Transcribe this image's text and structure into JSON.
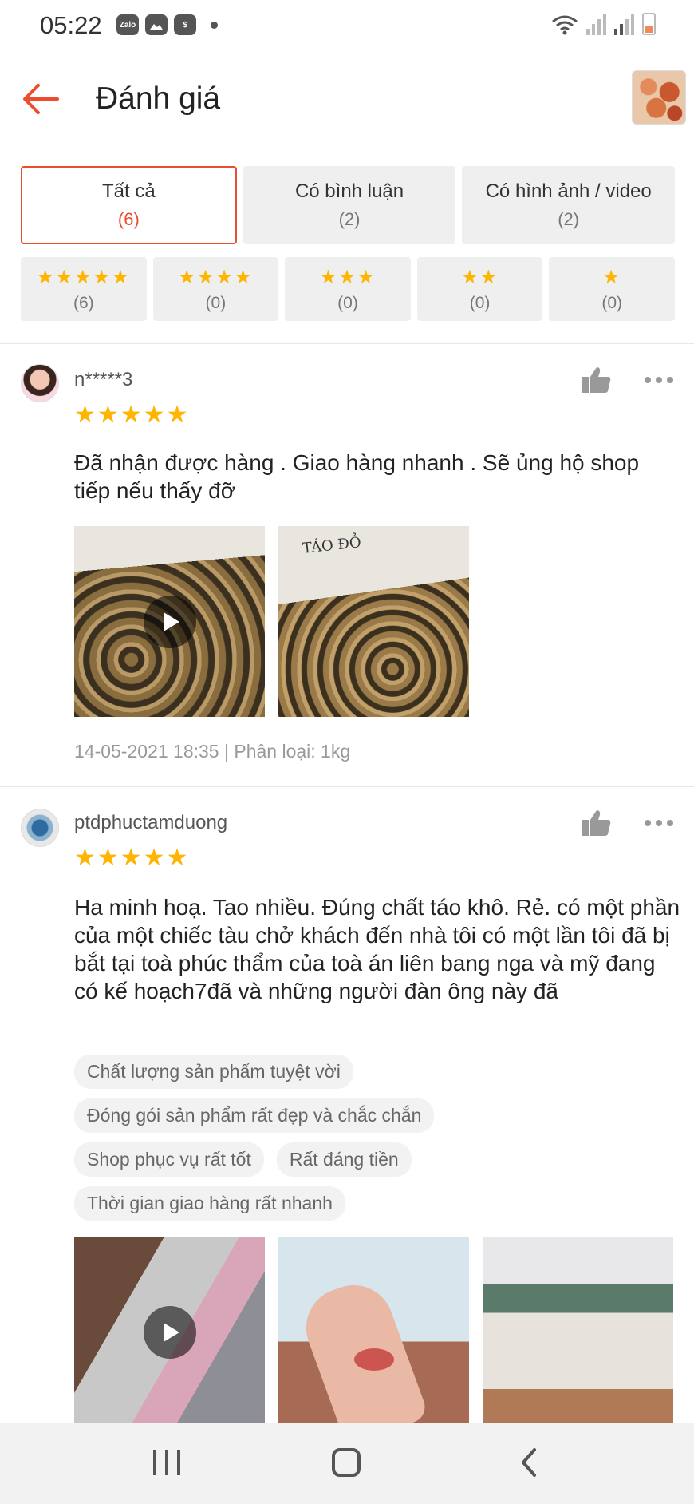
{
  "status_bar": {
    "time": "05:22",
    "app_icons": [
      "Zalo",
      "gallery-icon",
      "shield-dollar-icon"
    ]
  },
  "header": {
    "title": "Đánh giá",
    "back_icon": "arrow-left-icon",
    "accent_color": "#ee4d2d"
  },
  "tabs": [
    {
      "label": "Tất cả",
      "count": "(6)",
      "active": true
    },
    {
      "label": "Có bình luận",
      "count": "(2)",
      "active": false
    },
    {
      "label": "Có hình ảnh / video",
      "count": "(2)",
      "active": false
    }
  ],
  "star_filters": [
    {
      "stars": "★★★★★",
      "count": "(6)"
    },
    {
      "stars": "★★★★",
      "count": "(0)"
    },
    {
      "stars": "★★★",
      "count": "(0)"
    },
    {
      "stars": "★★",
      "count": "(0)"
    },
    {
      "stars": "★",
      "count": "(0)"
    }
  ],
  "reviews": [
    {
      "username": "n*****3",
      "stars": "★★★★★",
      "text": "Đã nhận được hàng . Giao hàng nhanh . Sẽ ủng hộ shop tiếp nếu thấy đỡ",
      "meta": "14-05-2021 18:35 | Phân loại: 1kg",
      "photo_label": "TÁO ĐỎ"
    },
    {
      "username": "ptdphuctamduong",
      "stars": "★★★★★",
      "text": "Ha minh hoạ. Tao nhiều. Đúng chất táo khô. Rẻ. có một phần của một chiếc tàu chở khách đến nhà tôi có một lần tôi đã bị bắt tại toà phúc thẩm của toà án liên bang nga và mỹ đang có kế hoạch7đã và những người đàn ông này đã",
      "tags": [
        "Chất lượng sản phẩm tuyệt vời",
        "Đóng gói sản phẩm rất đẹp và chắc chắn",
        "Shop phục vụ rất tốt",
        "Rất đáng tiền",
        "Thời gian giao hàng rất nhanh"
      ]
    }
  ]
}
